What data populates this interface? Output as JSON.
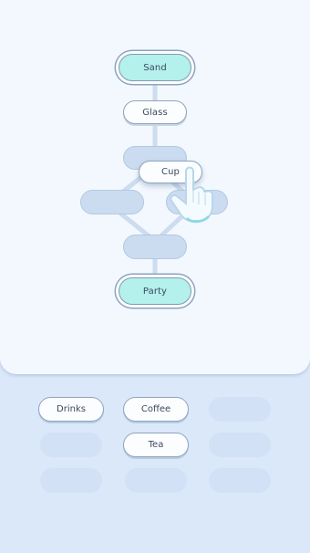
{
  "board": {
    "start_word": "Sand",
    "step_word": "Glass",
    "dragging_word": "Cup",
    "goal_word": "Party"
  },
  "tray": {
    "words": [
      "Drinks",
      "Coffee",
      "Tea"
    ]
  },
  "colors": {
    "goal_fill": "#b4f0ec",
    "board_bg": "#f3f8fe",
    "tray_bg": "#dbe8fa",
    "empty_slot": "#cbdcf1"
  }
}
